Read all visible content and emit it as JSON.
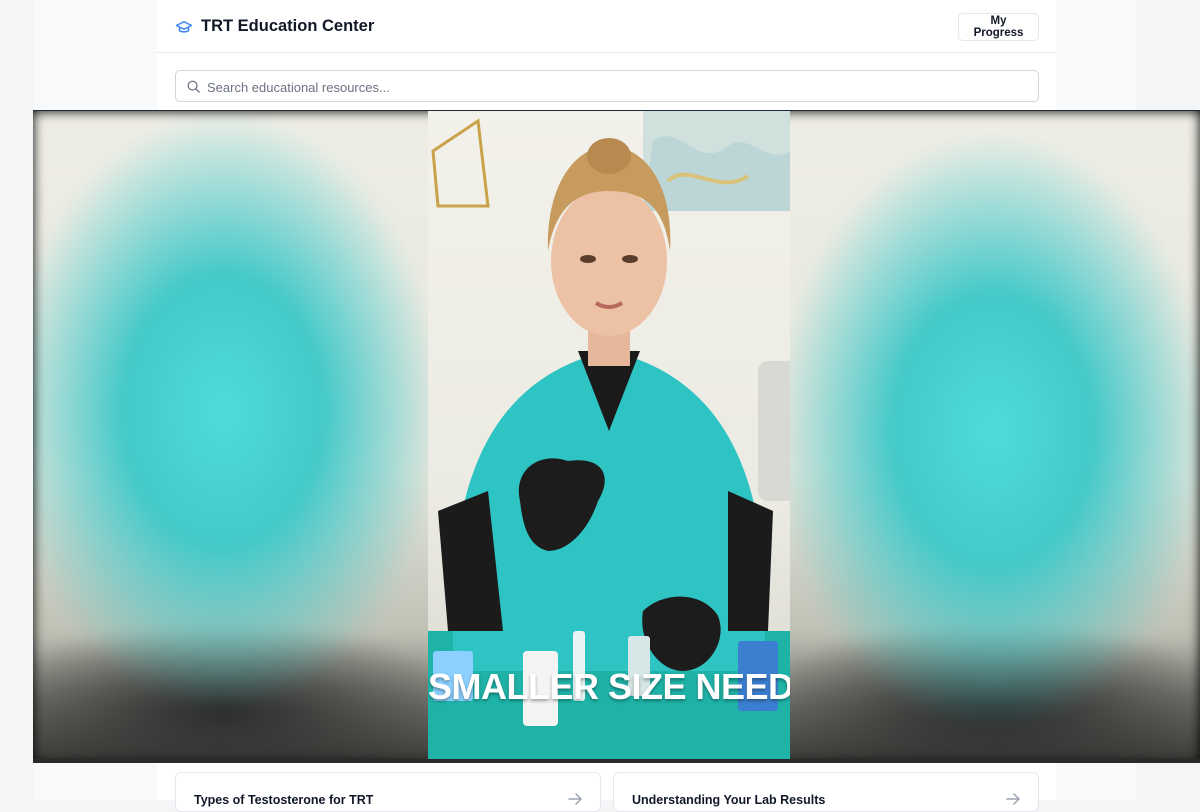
{
  "header": {
    "title": "TRT Education Center",
    "progress_button": "My Progress",
    "logo_icon": "graduation-cap-icon"
  },
  "search": {
    "placeholder": "Search educational resources..."
  },
  "video": {
    "caption": "SMALLER SIZE NEEDLE"
  },
  "cards": [
    {
      "title": "Types of Testosterone for TRT",
      "icon": "arrow-right-icon"
    },
    {
      "title": "Understanding Your Lab Results",
      "icon": "arrow-right-icon"
    }
  ],
  "colors": {
    "accent": "#3b82f6",
    "scrubs": "#2ec4c4"
  }
}
